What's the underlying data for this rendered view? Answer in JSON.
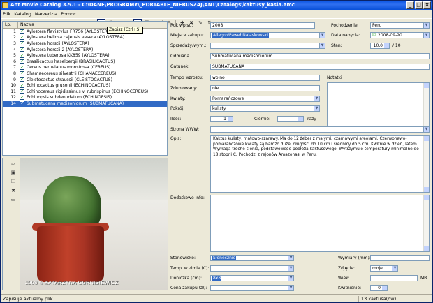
{
  "window": {
    "title": "Ant Movie Catalog 3.5.1 - C:\\DANE\\PROGRAMY\\_PORTABLE_NIERUSZAJ\\ANT\\Catalogs\\kaktusy_kasia.amc"
  },
  "menu": [
    "Plik",
    "Katalog",
    "Narzędzia",
    "Pomoc"
  ],
  "toolbar": {
    "tooltip": "Zapisz (Ctrl+S)"
  },
  "list": {
    "columns": [
      "Lp.",
      "Nazwa"
    ],
    "rows": [
      {
        "num": "1",
        "name": "Aylostera flavistylus FR756 (AYLOSTERA)"
      },
      {
        "num": "2",
        "name": "Aylostera heliosa cajensis vesera (AYLOSTERA)"
      },
      {
        "num": "3",
        "name": "Aylostera horstii (AYLOSTERA)"
      },
      {
        "num": "4",
        "name": "Aylostera horstii 2 (AYLOSTERA)"
      },
      {
        "num": "5",
        "name": "Aylostera tuberosa KK859 (AYLOSTERA)"
      },
      {
        "num": "6",
        "name": "Brasilicactus haselbergii (BRASILICACTUS)"
      },
      {
        "num": "7",
        "name": "Cereus peruvianus monstrosa (CEREUS)"
      },
      {
        "num": "8",
        "name": "Chamaecereus silvestrii (CHAMAECEREUS)"
      },
      {
        "num": "9",
        "name": "Cleistocactus straussii (CLEISTOCACTUS)"
      },
      {
        "num": "10",
        "name": "Echinocactus grusonii (ECHINOCACTUS)"
      },
      {
        "num": "11",
        "name": "Echinocereus rigidissimus v. rubrispinus (ECHINOCEREUS)"
      },
      {
        "num": "12",
        "name": "Echinopsis subdenudatum (ECHINOPSIS)"
      },
      {
        "num": "14",
        "name": "Submatucana madisoniorum (SUBMATUCANA)"
      }
    ],
    "selected_index": 12
  },
  "picture": {
    "watermark": "2008 © KATARZYNA GURNISIEWICZ"
  },
  "form": {
    "rok_wpisu": {
      "label": "Rok wpisu:",
      "value": "2008"
    },
    "pochodzenie": {
      "label": "Pochodzenie:",
      "value": "Peru"
    },
    "miejsce_zakupu": {
      "label": "Miejsce zakupu:",
      "value": "Allegro/Paweł Nalaskowski"
    },
    "data_nabycia": {
      "label": "Data nabycia:",
      "value": "2008-09-20"
    },
    "sprzedazywym": {
      "label": "Sprzedaży/wym.:",
      "value": ""
    },
    "stan": {
      "label": "Stan:",
      "value": "10,0",
      "suffix": "/ 10"
    },
    "odmiana": {
      "label": "Odmiana",
      "value": "Submatucana madisoniorum"
    },
    "gatunek": {
      "label": "Gatunek",
      "value": "SUBMATUCANA"
    },
    "tempo": {
      "label": "Tempo wzrostu:",
      "value": "wolno"
    },
    "notatki": {
      "label": "Notatki"
    },
    "zdublowany": {
      "label": "Zdublowany:",
      "value": "nie"
    },
    "kwiaty": {
      "label": "Kwiaty:",
      "value": "Pomarańczowe"
    },
    "pokroj": {
      "label": "Pokrój:",
      "value": "kulisty"
    },
    "ilosc": {
      "label": "Ilość:",
      "value": "1"
    },
    "ciernie": {
      "label": "Ciernie:",
      "value": "",
      "suffix": "razy"
    },
    "strona": {
      "label": "Strona WWW:",
      "value": ""
    },
    "opis": {
      "label": "Opis:",
      "value": "Kaktus kulisty, matowo-szarawy. Ma do 12 żeber z małymi, czarnawymi areolami. Czerwonawo-pomarańczowe kwiaty są bardzo duże, długości do 10 cm i średnicy do 5 cm. Kwitnie w dzień, latem. Wymaga trochę cienia, podstawowego podłoża kaktusowego. Wytrzymuje temperatury minimalne do 18 stopni C. Pochodzi z rejonów Amazonas, w Peru."
    },
    "dodatkowe": {
      "label": "Dodatkowe info:",
      "value": ""
    },
    "stanowisko": {
      "label": "Stanowisko:",
      "value": "Słonecznie"
    },
    "wymiary": {
      "label": "Wymiary (mm):",
      "value": ""
    },
    "temp": {
      "label": "Temp. w zimie (C):",
      "value": ""
    },
    "zdjecie": {
      "label": "Zdjęcie:",
      "value": "moje"
    },
    "doniczka": {
      "label": "Doniczka (cm):",
      "value": "8x8"
    },
    "wiek": {
      "label": "Wiek:",
      "value": "",
      "suffix": "MB"
    },
    "cena": {
      "label": "Cena zakupu (zł):",
      "value": ""
    },
    "kwitnienie": {
      "label": "Kwitnienie:",
      "value": "0"
    }
  },
  "status": {
    "left": "Zapisuje aktualny plik",
    "right": "13 kaktusa(ów)"
  }
}
